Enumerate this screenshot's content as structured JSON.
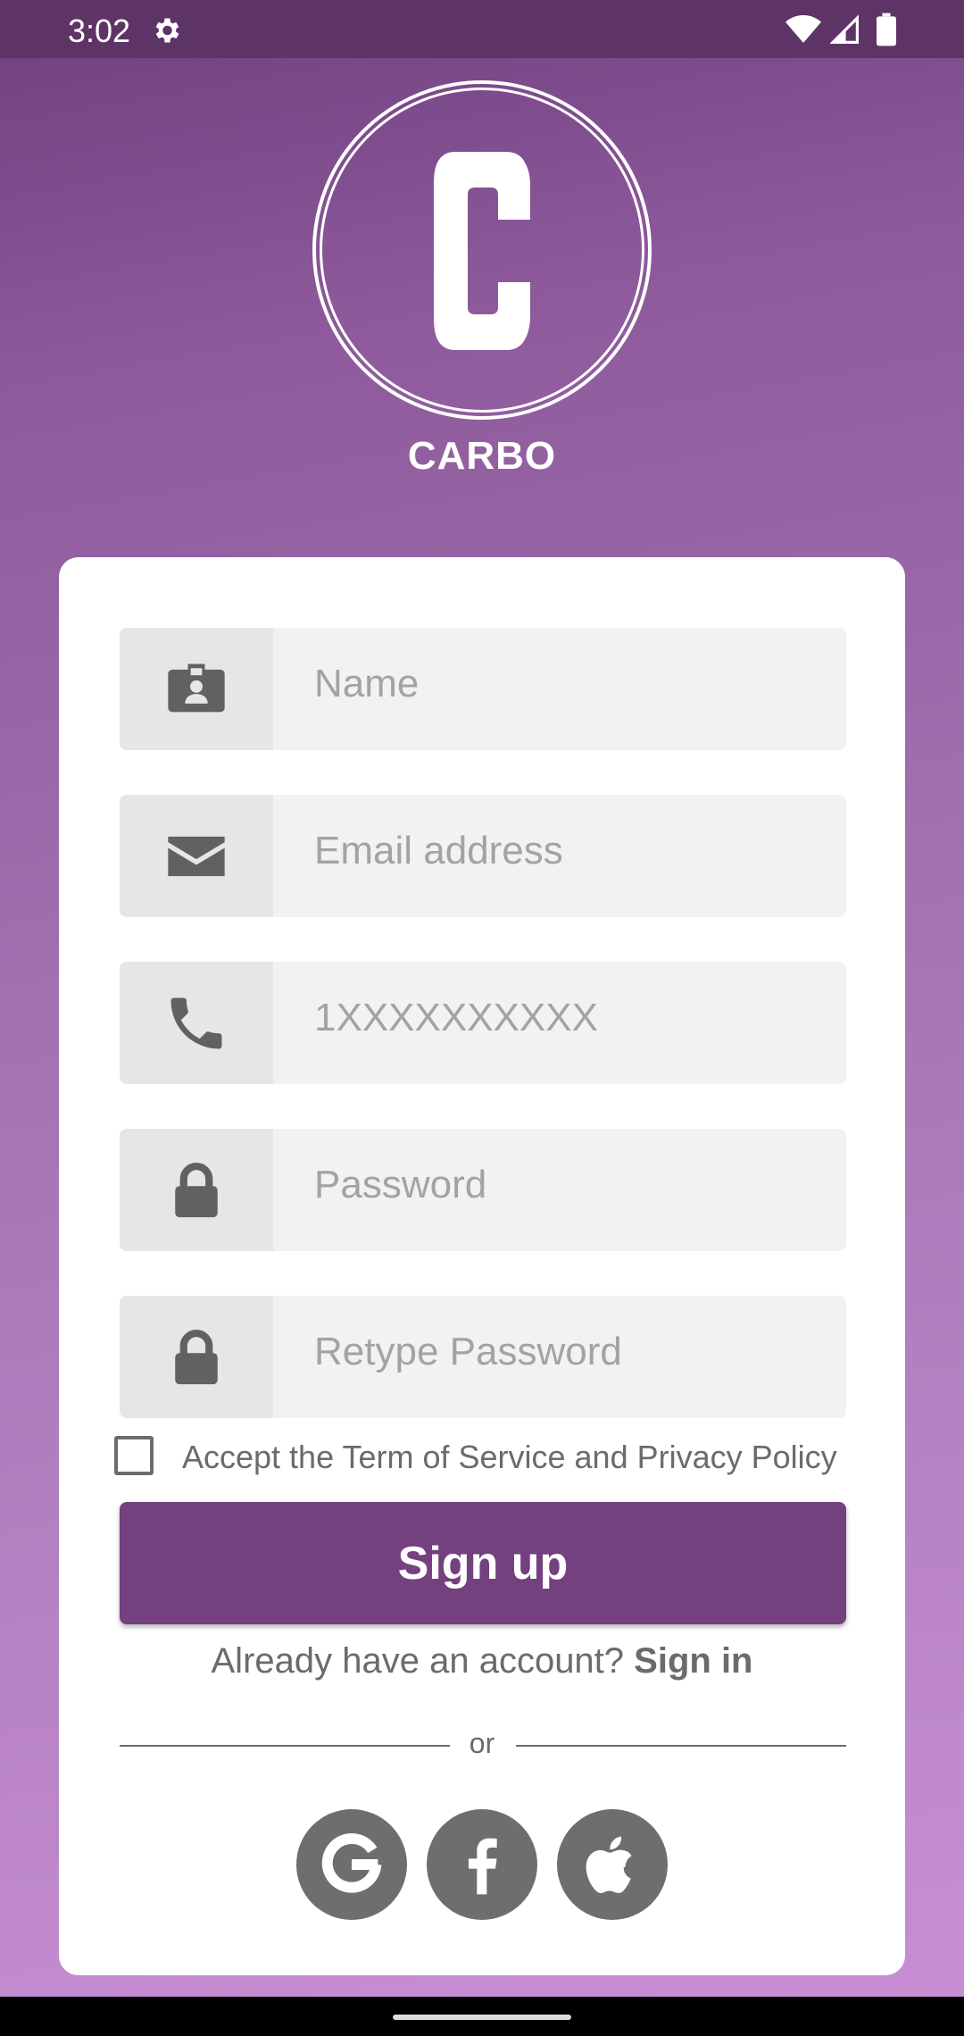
{
  "status_bar": {
    "time": "3:02"
  },
  "brand": {
    "logo_letter": "C",
    "name": "CARBO"
  },
  "form": {
    "fields": [
      {
        "icon": "id-badge-icon",
        "placeholder": "Name",
        "value": ""
      },
      {
        "icon": "envelope-icon",
        "placeholder": "Email address",
        "value": ""
      },
      {
        "icon": "phone-icon",
        "placeholder": "1XXXXXXXXXX",
        "value": ""
      },
      {
        "icon": "lock-icon",
        "placeholder": "Password",
        "value": ""
      },
      {
        "icon": "lock-icon",
        "placeholder": "Retype Password",
        "value": ""
      }
    ],
    "terms_label": "Accept the Term of Service and Privacy Policy",
    "terms_checked": false,
    "signup_label": "Sign up",
    "signin_prompt": "Already have an account?",
    "signin_link": "Sign in",
    "or_label": "or",
    "social": [
      {
        "icon": "google-icon"
      },
      {
        "icon": "facebook-icon"
      },
      {
        "icon": "apple-icon"
      }
    ]
  },
  "colors": {
    "primary": "#74407e",
    "status_bar": "#5e3466",
    "gradient_top": "#6e3f7d",
    "gradient_bottom": "#c98fd6"
  }
}
